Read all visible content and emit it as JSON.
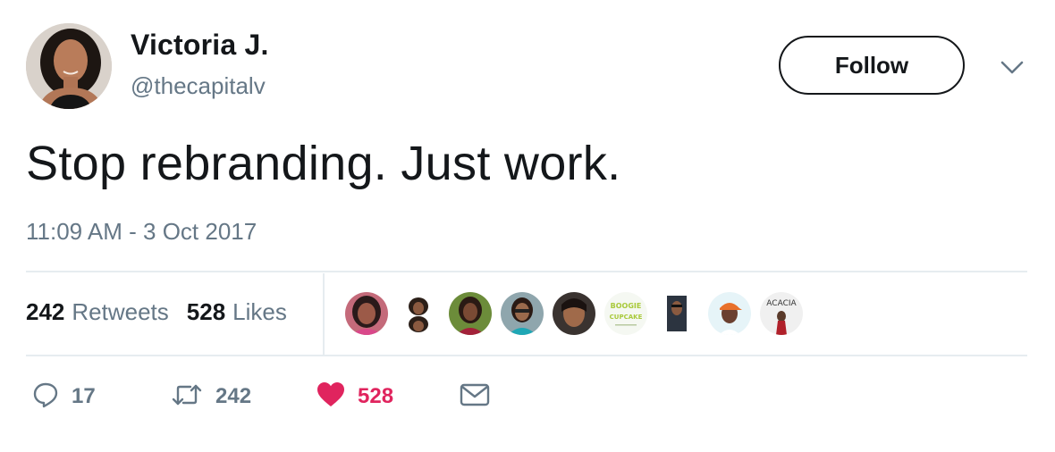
{
  "author": {
    "display_name": "Victoria J.",
    "handle": "@thecapitalv"
  },
  "follow_label": "Follow",
  "tweet": {
    "text": "Stop rebranding. Just work.",
    "timestamp": "11:09 AM - 3 Oct 2017"
  },
  "stats": {
    "retweets_count": "242",
    "retweets_label": "Retweets",
    "likes_count": "528",
    "likes_label": "Likes"
  },
  "liker_avatars": [
    {
      "name": "liker-1",
      "bg": "#c46a7a"
    },
    {
      "name": "liker-2",
      "bg": "#f3efe9"
    },
    {
      "name": "liker-3",
      "bg": "#6c8c3a"
    },
    {
      "name": "liker-4",
      "bg": "#5e8fa3"
    },
    {
      "name": "liker-5",
      "bg": "#3a3330"
    },
    {
      "name": "liker-6",
      "bg": "#f2f7ef",
      "text": "BOOGIE CUPCAKE"
    },
    {
      "name": "liker-7",
      "bg": "#f5f5f5"
    },
    {
      "name": "liker-8",
      "bg": "#e6f4f8"
    },
    {
      "name": "liker-9",
      "bg": "#eeeeee",
      "text": "ACACIA"
    }
  ],
  "actions": {
    "reply_count": "17",
    "retweet_count": "242",
    "like_count": "528"
  },
  "colors": {
    "text_primary": "#14171a",
    "text_secondary": "#657786",
    "like_accent": "#e0245e",
    "divider": "#e6ecf0"
  },
  "icons": {
    "reply": "reply-icon",
    "retweet": "retweet-icon",
    "like": "heart-icon",
    "dm": "envelope-icon",
    "menu": "chevron-down-icon"
  }
}
